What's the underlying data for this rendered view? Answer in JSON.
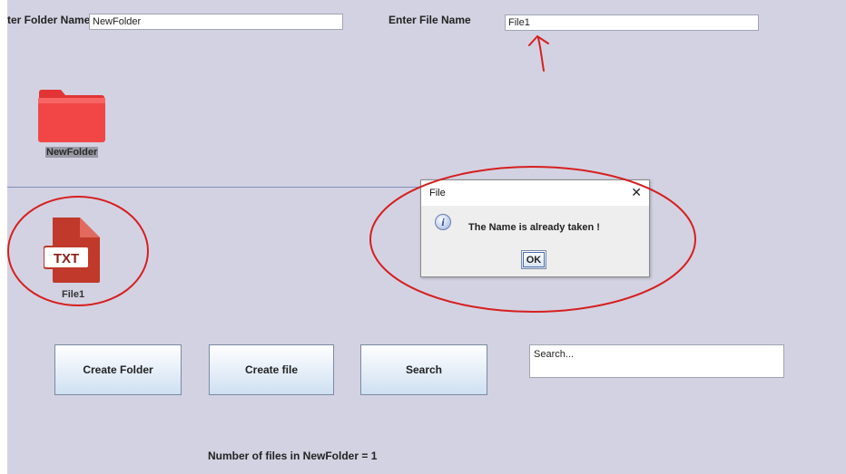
{
  "header": {
    "folder_label": "ter Folder Name",
    "folder_value": "NewFolder",
    "file_label": "Enter File Name",
    "file_value": "File1"
  },
  "folder_item": {
    "label": "NewFolder"
  },
  "file_item": {
    "label": "File1",
    "badge": "TXT"
  },
  "buttons": {
    "create_folder": "Create Folder",
    "create_file": "Create file",
    "search": "Search"
  },
  "search": {
    "placeholder": "Search..."
  },
  "status": "Number of files in NewFolder = 1",
  "dialog": {
    "title": "File",
    "close": "✕",
    "message": "The Name is already taken !",
    "ok": "OK"
  },
  "colors": {
    "background": "#d3d2e2",
    "folder": "#f03c3c",
    "txt_icon": "#c0392b",
    "annotation": "#d61f1f"
  },
  "icons": [
    "folder-icon",
    "txt-file-icon",
    "info-icon",
    "close-icon"
  ]
}
